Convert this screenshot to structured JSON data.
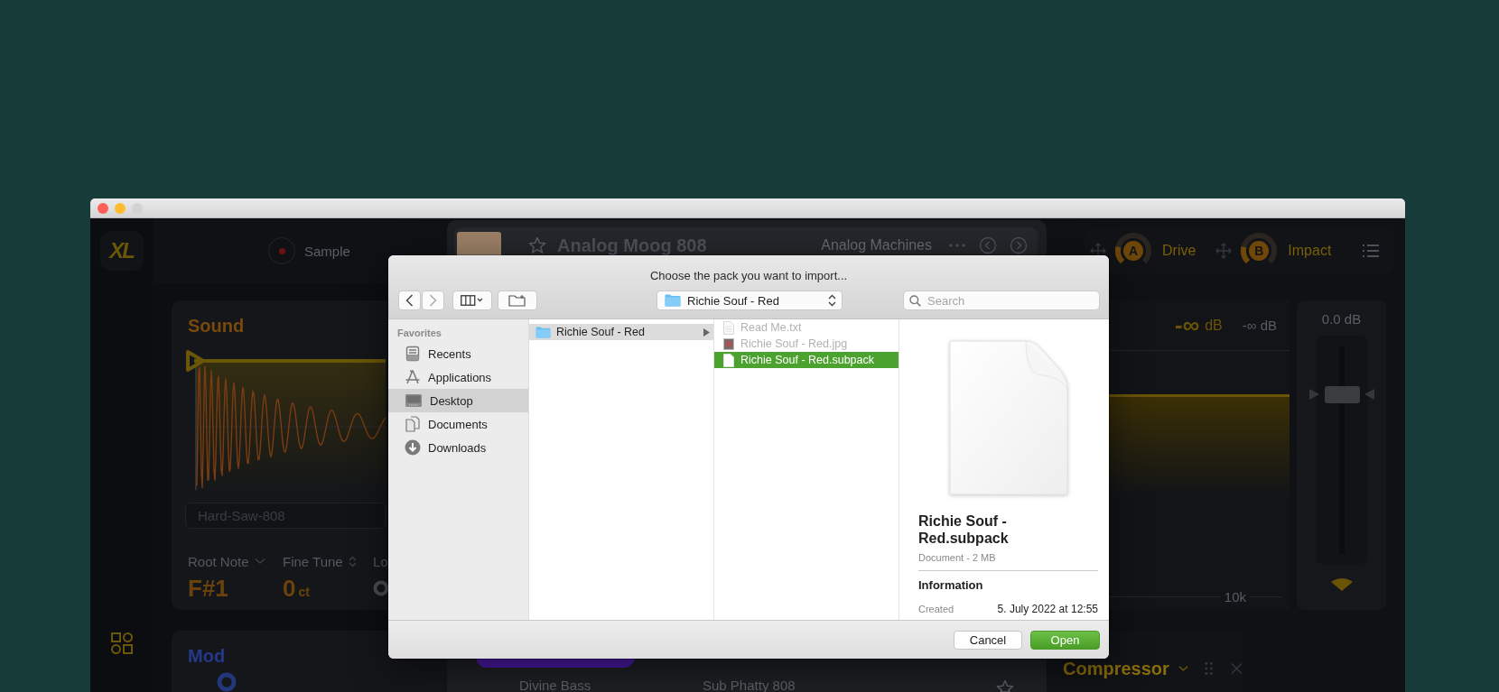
{
  "app": {
    "logo": "XL",
    "sample_button": {
      "label": "Sample"
    },
    "preset": {
      "title": "Analog Moog 808",
      "pack": "Analog Machines",
      "favorite": false
    },
    "macros": [
      {
        "badge": "A",
        "label": "Drive",
        "level": 0.22
      },
      {
        "badge": "B",
        "label": "Impact",
        "level": 0.22
      }
    ],
    "sound": {
      "title": "Sound",
      "sample_name": "Hard-Saw-808",
      "params": [
        {
          "kind": "dropdown",
          "label": "Root Note",
          "value": "F#1"
        },
        {
          "kind": "stepper",
          "label": "Fine Tune",
          "value": "0",
          "unit": "ct"
        },
        {
          "kind": "knob",
          "label": "Lo"
        }
      ]
    },
    "meter": {
      "peak": "-∞",
      "peak_unit": "dB",
      "secondary": "-∞ dB",
      "axis_label": "10k"
    },
    "fader": {
      "reading": "0.0 dB",
      "level": 0.76
    },
    "mod": {
      "title": "Mod"
    },
    "preset_row": {
      "names": [
        "Divine Bass",
        "Sub Phatty 808"
      ],
      "favorite": false
    },
    "effect": {
      "title": "Compressor"
    }
  },
  "dialog": {
    "title": "Choose the pack you want to import...",
    "location": "Richie Souf - Red",
    "search": {
      "placeholder": "Search"
    },
    "sidebar": {
      "heading": "Favorites",
      "items": [
        {
          "kind": "recents",
          "label": "Recents",
          "selected": false
        },
        {
          "kind": "applications",
          "label": "Applications",
          "selected": false
        },
        {
          "kind": "desktop",
          "label": "Desktop",
          "selected": true
        },
        {
          "kind": "documents",
          "label": "Documents",
          "selected": false
        },
        {
          "kind": "downloads",
          "label": "Downloads",
          "selected": false
        }
      ]
    },
    "folders": [
      {
        "name": "Richie Souf - Red",
        "selected": true
      }
    ],
    "files": [
      {
        "kind": "text",
        "name": "Read Me.txt",
        "disabled": true,
        "selected": false
      },
      {
        "kind": "image",
        "name": "Richie Souf - Red.jpg",
        "disabled": true,
        "selected": false
      },
      {
        "kind": "document",
        "name": "Richie Souf - Red.subpack",
        "disabled": false,
        "selected": true
      }
    ],
    "preview": {
      "name": "Richie Souf - Red.subpack",
      "meta": "Document - 2 MB",
      "section": "Information",
      "fields": [
        {
          "label": "Created",
          "value": "5. July 2022 at 12:55"
        }
      ]
    },
    "buttons": [
      {
        "kind": "secondary",
        "label": "Cancel"
      },
      {
        "kind": "primary",
        "label": "Open"
      }
    ]
  }
}
